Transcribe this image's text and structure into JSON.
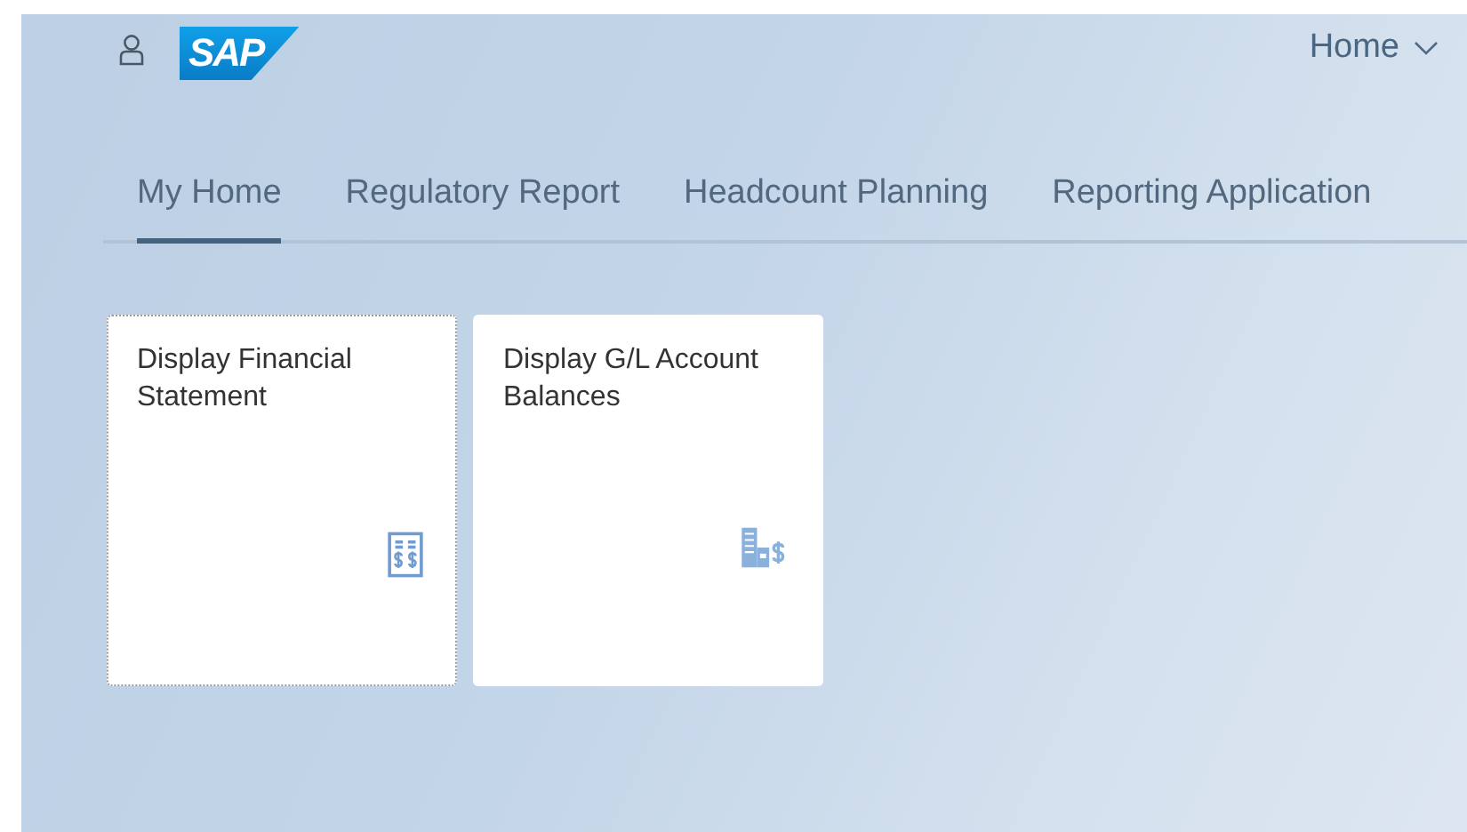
{
  "header": {
    "logo": "SAP",
    "menu": "Home"
  },
  "tabs": [
    {
      "label": "My Home",
      "selected": true
    },
    {
      "label": "Regulatory Report",
      "selected": false
    },
    {
      "label": "Headcount Planning",
      "selected": false
    },
    {
      "label": "Reporting Application",
      "selected": false
    }
  ],
  "tiles": [
    {
      "title": "Display Financial Statement",
      "focused": true
    },
    {
      "title": "Display G/L Account Balances",
      "focused": false
    }
  ]
}
